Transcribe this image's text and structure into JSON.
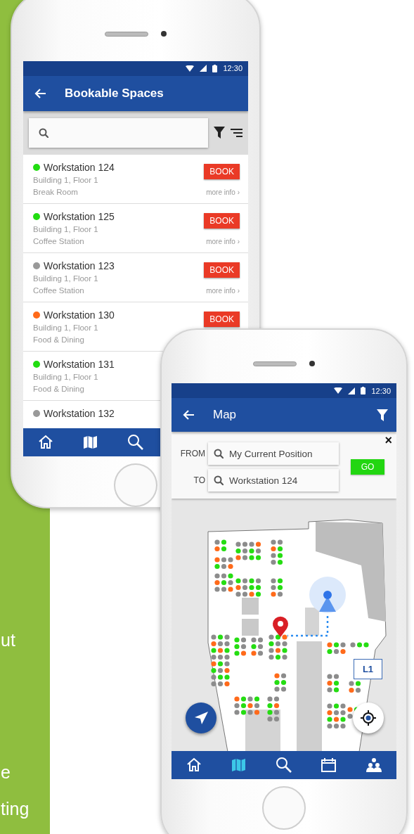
{
  "side_panel": {
    "text_fragments": [
      "ut",
      "e",
      "ting"
    ]
  },
  "phones": [
    {
      "kind": "list",
      "status_bar": {
        "time": "12:30"
      },
      "app_bar": {
        "title": "Bookable Spaces"
      },
      "spaces": [
        {
          "name": "Workstation 124",
          "color": "#22dd11",
          "building": "Building 1, Floor 1",
          "area": "Break Room",
          "book": "BOOK",
          "more_info": "more info ›"
        },
        {
          "name": "Workstation 125",
          "color": "#22dd11",
          "building": "Building 1, Floor 1",
          "area": "Coffee Station",
          "book": "BOOK",
          "more_info": "more info ›"
        },
        {
          "name": "Workstation 123",
          "color": "#999999",
          "building": "Building 1, Floor 1",
          "area": "Coffee Station",
          "book": "BOOK",
          "more_info": "more info ›"
        },
        {
          "name": "Workstation 130",
          "color": "#ff6a1a",
          "building": "Building 1, Floor 1",
          "area": "Food & Dining",
          "book": "BOOK"
        },
        {
          "name": "Workstation 131",
          "color": "#22dd11",
          "building": "Building 1, Floor 1",
          "area": "Food & Dining"
        },
        {
          "name": "Workstation 132",
          "color": "#999999"
        }
      ],
      "nav": [
        {
          "kind": "home",
          "selected": false
        },
        {
          "kind": "map",
          "selected": false
        },
        {
          "kind": "search",
          "selected": false
        }
      ]
    },
    {
      "kind": "map",
      "status_bar": {
        "time": "12:30"
      },
      "app_bar": {
        "title": "Map"
      },
      "route": {
        "from_label": "FROM",
        "from": "My Current Position",
        "to_label": "TO",
        "to": "Workstation 124",
        "go": "GO",
        "close": "×"
      },
      "level": "L1",
      "nav": [
        {
          "kind": "home",
          "selected": false
        },
        {
          "kind": "map",
          "selected": true
        },
        {
          "kind": "search",
          "selected": false
        },
        {
          "kind": "calendar",
          "selected": false
        },
        {
          "kind": "people",
          "selected": false
        }
      ]
    }
  ]
}
